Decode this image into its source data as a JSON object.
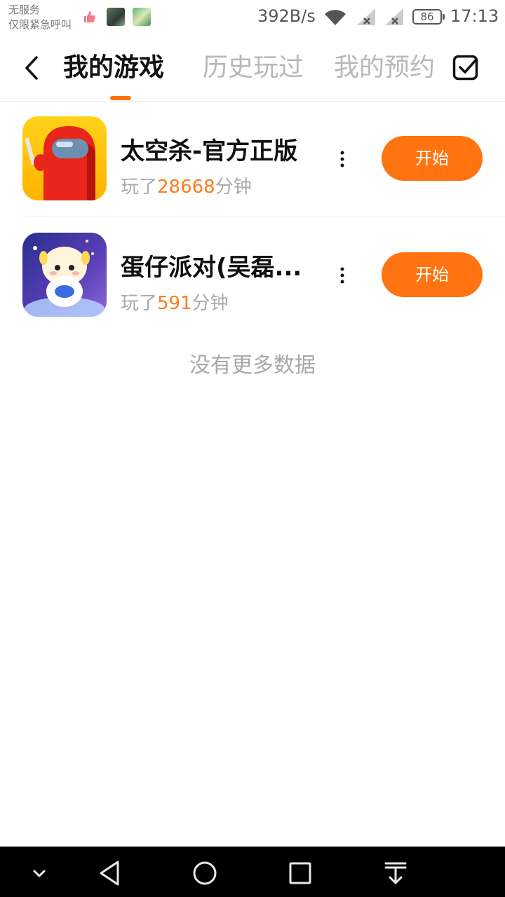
{
  "status_bar": {
    "carrier_line1": "无服务",
    "carrier_line2": "仅限紧急呼叫",
    "net_speed": "392B/s",
    "battery": "86",
    "time": "17:13",
    "icons": [
      "thumbs-up-icon",
      "app-notification-icon",
      "app-notification-icon",
      "wifi-icon",
      "signal-no-service-icon",
      "signal-no-service-icon",
      "battery-icon"
    ]
  },
  "header": {
    "back_icon": "chevron-left-icon",
    "tabs": [
      {
        "label": "我的游戏",
        "active": true
      },
      {
        "label": "历史玩过",
        "active": false
      },
      {
        "label": "我的预约",
        "active": false
      }
    ],
    "manage_icon": "checkbox-icon",
    "accent_color": "#ff7310"
  },
  "games": [
    {
      "name": "太空杀-官方正版",
      "played_prefix": "玩了",
      "played_minutes": "28668",
      "played_suffix": "分钟",
      "action_label": "开始",
      "icon": "game-icon-space-killer",
      "more_icon": "more-vertical-icon"
    },
    {
      "name": "蛋仔派对(吴磊...",
      "played_prefix": "玩了",
      "played_minutes": "591",
      "played_suffix": "分钟",
      "action_label": "开始",
      "icon": "game-icon-eggy-party",
      "more_icon": "more-vertical-icon"
    }
  ],
  "footer_text": "没有更多数据",
  "nav_bar": {
    "buttons": [
      "collapse-icon",
      "back-triangle-icon",
      "home-circle-icon",
      "recents-square-icon",
      "notification-pull-icon"
    ]
  }
}
